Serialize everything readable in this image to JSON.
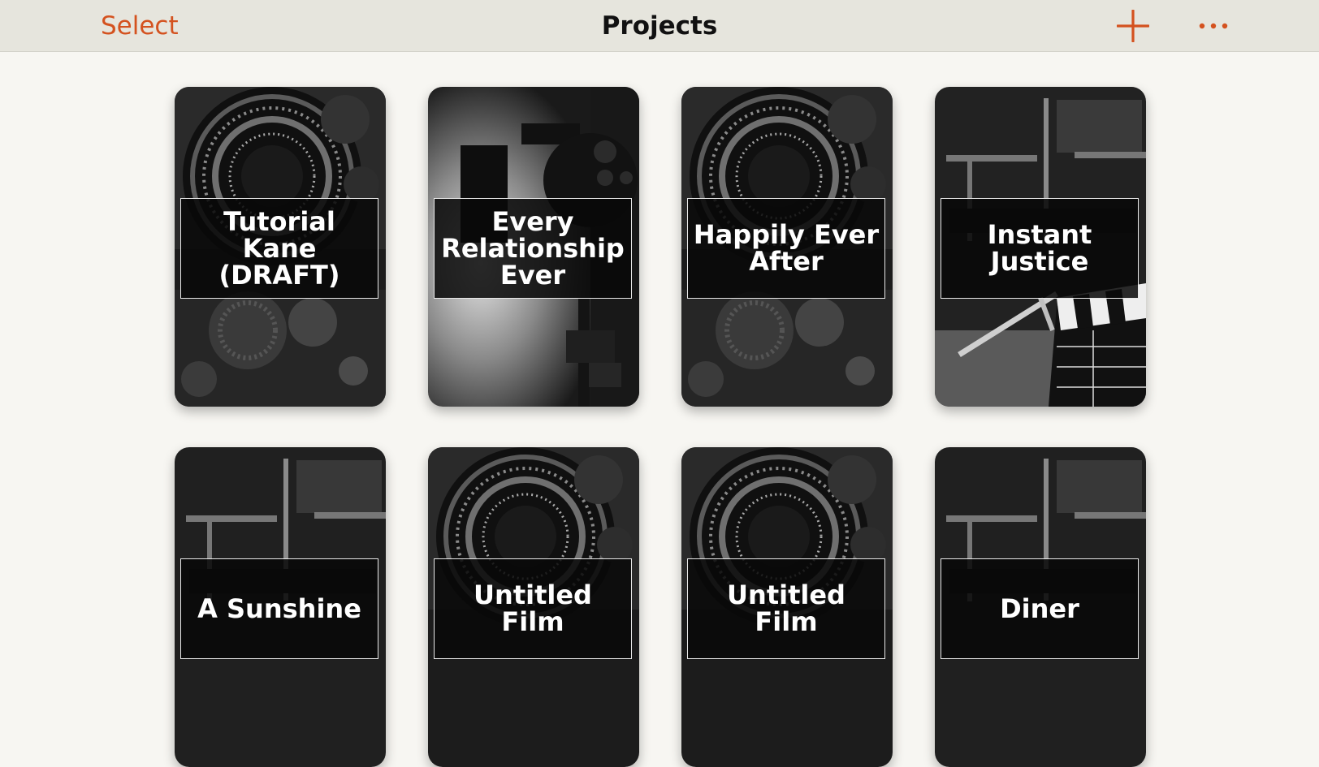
{
  "navbar": {
    "select_label": "Select",
    "title": "Projects",
    "add_icon": "plus-icon",
    "more_icon": "ellipsis-icon",
    "accent_color": "#d4521f"
  },
  "projects": [
    {
      "title": "Tutorial Kane (DRAFT)",
      "image": "camera-lens"
    },
    {
      "title": "Every Relationship Ever",
      "image": "studio-light"
    },
    {
      "title": "Happily Ever After",
      "image": "camera-lens"
    },
    {
      "title": "Instant Justice",
      "image": "directors-chair-clapperboard"
    },
    {
      "title": "A Sunshine",
      "image": "directors-chair"
    },
    {
      "title": "Untitled Film",
      "image": "camera-lens"
    },
    {
      "title": "Untitled Film",
      "image": "camera-lens"
    },
    {
      "title": "Diner",
      "image": "directors-chair"
    }
  ]
}
